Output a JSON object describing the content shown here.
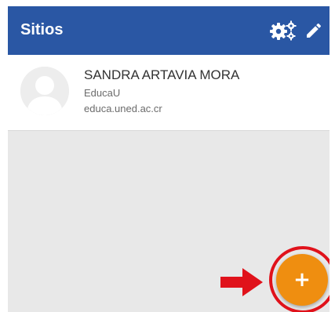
{
  "appbar": {
    "title": "Sitios",
    "icons": [
      "settings-icon",
      "pencil-icon"
    ],
    "color": "#2a57a4"
  },
  "sites": [
    {
      "name": "SANDRA ARTAVIA MORA",
      "organization": "EducaU",
      "url": "educa.uned.ac.cr",
      "avatar_icon": "default-user-avatar"
    }
  ],
  "fab": {
    "label": "+",
    "icon": "add-icon",
    "color": "#ef8e10"
  },
  "annotation": {
    "arrow_icon": "red-arrow-right",
    "highlight_color": "#e0121b"
  },
  "background_color": "#e8e8e8"
}
